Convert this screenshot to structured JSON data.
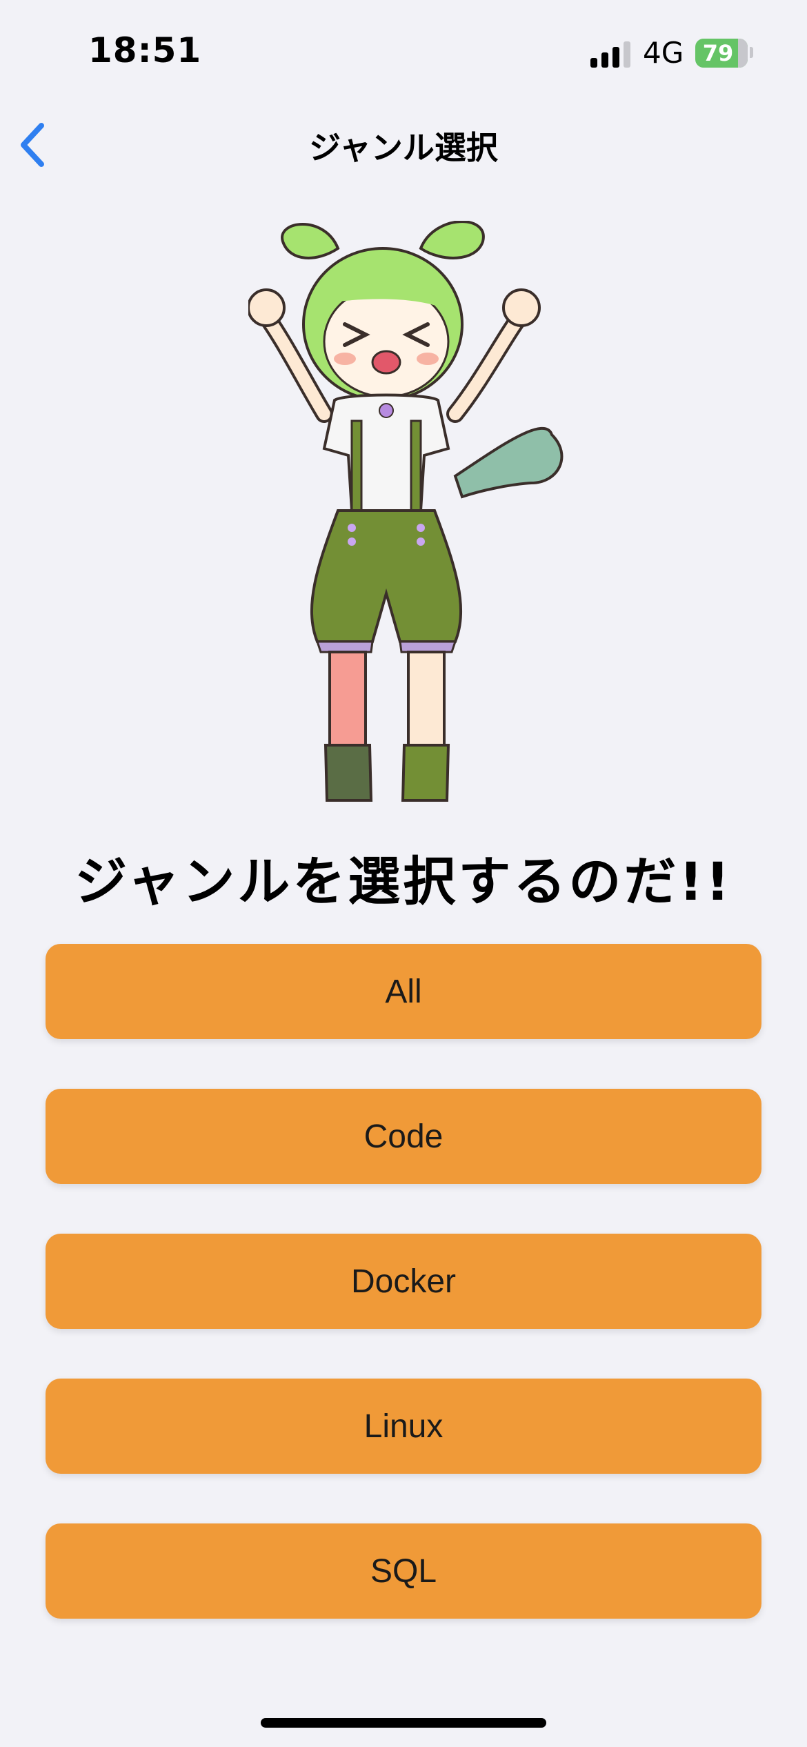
{
  "status_bar": {
    "time": "18:51",
    "network": "4G",
    "battery": "79"
  },
  "nav": {
    "title": "ジャンル選択"
  },
  "headline": "ジャンルを選択するのだ!!",
  "genres": [
    {
      "label": "All"
    },
    {
      "label": "Code"
    },
    {
      "label": "Docker"
    },
    {
      "label": "Linux"
    },
    {
      "label": "SQL"
    }
  ],
  "colors": {
    "background": "#f2f2f7",
    "button": "#f09a38",
    "accent": "#2f7ff0",
    "battery": "#65c466"
  },
  "icons": {
    "back": "chevron-left-icon",
    "signal": "cellular-signal-icon",
    "battery": "battery-charging-icon"
  }
}
